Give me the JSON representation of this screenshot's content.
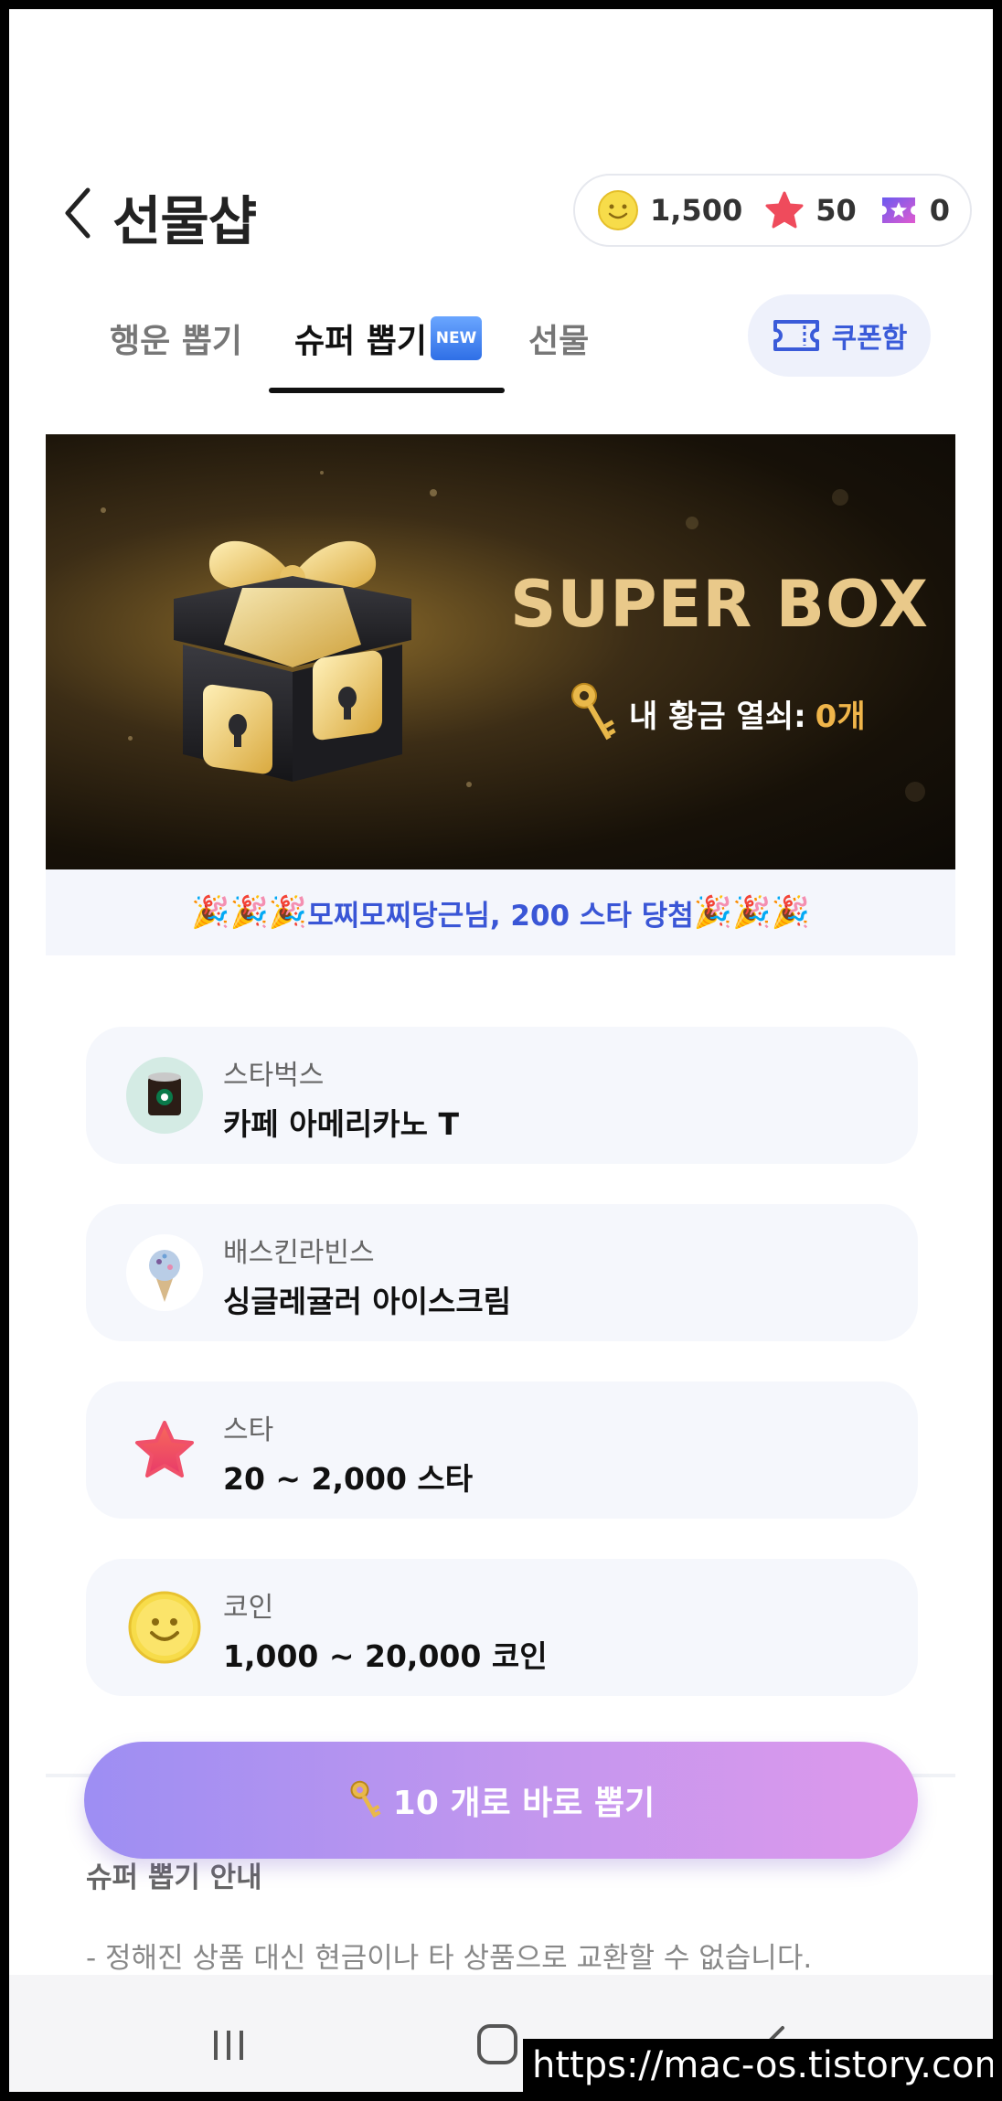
{
  "header": {
    "title": "선물샵",
    "wallet": {
      "coins": "1,500",
      "stars": "50",
      "tickets": "0"
    }
  },
  "tabs": [
    {
      "label": "행운 뽑기",
      "active": false
    },
    {
      "label": "슈퍼 뽑기",
      "badge": "NEW",
      "active": true
    },
    {
      "label": "선물",
      "active": false
    }
  ],
  "coupon_button": {
    "label": "쿠폰함"
  },
  "banner": {
    "title": "SUPER BOX",
    "key_label": "내 황금 열쇠:",
    "key_count": "0개"
  },
  "ticker": {
    "message": "모찌모찌당근님, 200 스타 당첨"
  },
  "prizes": [
    {
      "brand": "스타벅스",
      "name": "카페 아메리카노 T",
      "icon": "starbucks-cup-icon"
    },
    {
      "brand": "배스킨라빈스",
      "name": "싱글레귤러 아이스크림",
      "icon": "ice-cream-icon"
    },
    {
      "brand": "스타",
      "name": "20 ~ 2,000 스타",
      "icon": "star-icon"
    },
    {
      "brand": "코인",
      "name": "1,000 ~ 20,000 코인",
      "icon": "smiley-coin-icon"
    }
  ],
  "draw_button": {
    "label": "10 개로 바로 뽑기"
  },
  "info": {
    "title": "슈퍼 뽑기 안내",
    "line1": "- 정해진 상품 대신 현금이나 타 상품으로 교환할 수 없습니다."
  },
  "watermark": "https://mac-os.tistory.com",
  "colors": {
    "accent_blue": "#3a56d6",
    "gold": "#e9c98a",
    "key_orange": "#f0b54a"
  }
}
